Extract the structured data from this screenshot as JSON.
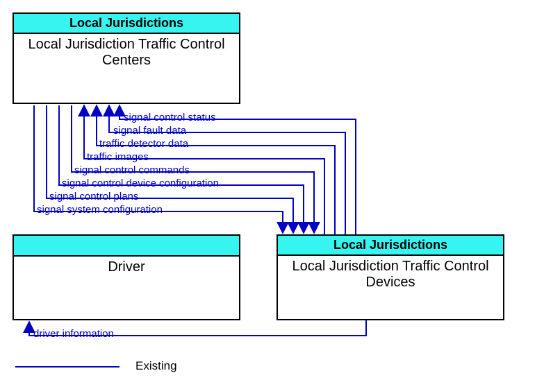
{
  "nodes": {
    "top": {
      "header": "Local Jurisdictions",
      "title": "Local Jurisdiction Traffic Control Centers"
    },
    "driver": {
      "header": "",
      "title": "Driver"
    },
    "devices": {
      "header": "Local Jurisdictions",
      "title": "Local Jurisdiction Traffic Control Devices"
    }
  },
  "flows": {
    "f1": "signal control status",
    "f2": "signal fault data",
    "f3": "traffic detector data",
    "f4": "traffic images",
    "f5": "signal control commands",
    "f6": "signal control device configuration",
    "f7": "signal control plans",
    "f8": "signal system configuration",
    "f9": "driver information"
  },
  "legend": {
    "existing": "Existing"
  },
  "colors": {
    "arrow": "#0000C4",
    "header": "#36F4F0"
  }
}
